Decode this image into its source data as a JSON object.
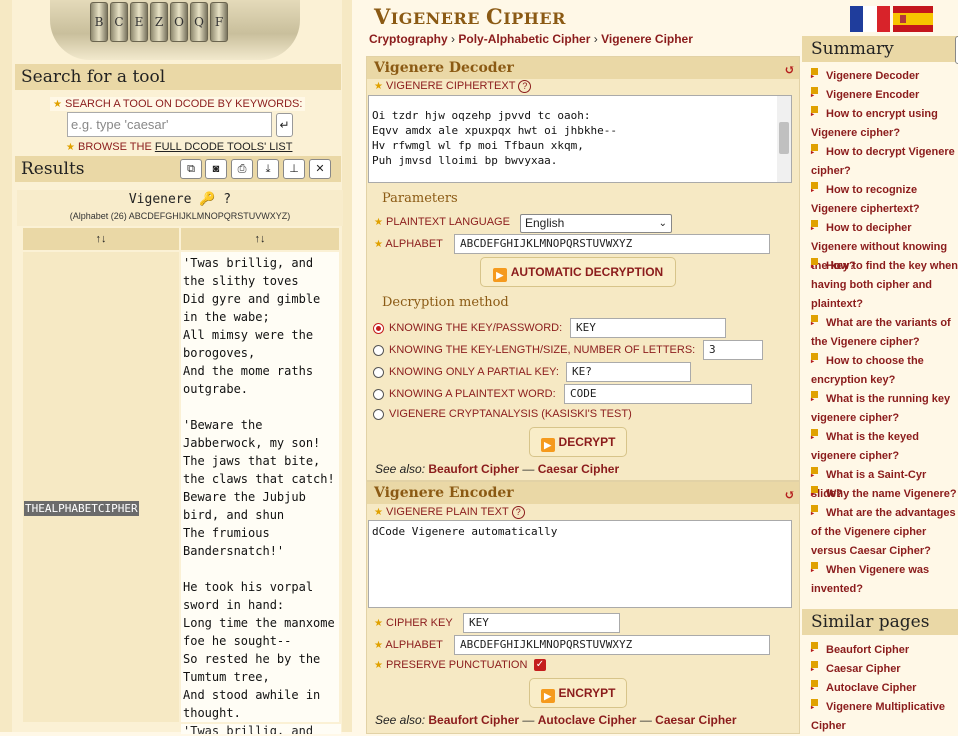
{
  "search": {
    "heading": "Search for a tool",
    "keywords_label": "SEARCH A TOOL ON DCODE BY KEYWORDS:",
    "placeholder": "e.g. type 'caesar'",
    "browse_prefix": "BROWSE THE",
    "browse_link": "FULL DCODE TOOLS' LIST"
  },
  "results": {
    "heading": "Results",
    "title": "Vigenere",
    "title_icons": "🔑 ?",
    "subtitle": "(Alphabet (26) ABCDEFGHIJKLMNOPQRSTUVWXYZ)",
    "col1_sort": "↑↓",
    "col2_sort": "↑↓",
    "key_cell": "THEALPHABETCIPHER",
    "plaintext": "'Twas brillig, and\nthe slithy toves\nDid gyre and gimble\nin the wabe;\nAll mimsy were the\nborogoves,\nAnd the mome raths\noutgrabe.\n\n'Beware the\nJabberwock, my son!\nThe jaws that bite,\nthe claws that catch!\nBeware the Jubjub\nbird, and shun\nThe frumious\nBandersnatch!'\n\nHe took his vorpal\nsword in hand:\nLong time the manxome\nfoe he sought--\nSo rested he by the\nTumtum tree,\nAnd stood awhile in\nthought.",
    "next_row": "'Twas brillig, and"
  },
  "page": {
    "title_first": "V",
    "title_rest1": "IGENERE ",
    "title_second": "C",
    "title_rest2": "IPHER",
    "breadcrumb": [
      "Cryptography",
      "Poly-Alphabetic Cipher",
      "Vigenere Cipher"
    ],
    "breadcrumb_sep": "›"
  },
  "decoder": {
    "heading": "Vigenere Decoder",
    "reload": "↺",
    "ciphertext_label": "VIGENERE CIPHERTEXT",
    "ciphertext": "Oi tzdr hjw oqzehp jpvvd tc oaoh:\nEqvv amdx ale xpuxpqx hwt oi jhbkhe--\nHv rfwmgl wl fp moi Tfbaun xkqm,\nPuh jmvsd lloimi bp bwvyxaa.",
    "parameters_heading": "Parameters",
    "language_label": "PLAINTEXT LANGUAGE",
    "language_value": "English",
    "alphabet_label": "ALPHABET",
    "alphabet_value": "ABCDEFGHIJKLMNOPQRSTUVWXYZ",
    "auto_button": "AUTOMATIC DECRYPTION",
    "method_heading": "Decryption method",
    "methods": [
      {
        "label": "KNOWING THE KEY/PASSWORD:",
        "value": "KEY",
        "selected": true
      },
      {
        "label": "KNOWING THE KEY-LENGTH/SIZE, NUMBER OF LETTERS:",
        "value": "3",
        "selected": false
      },
      {
        "label": "KNOWING ONLY A PARTIAL KEY:",
        "value": "KE?",
        "selected": false
      },
      {
        "label": "KNOWING A PLAINTEXT WORD:",
        "value": "CODE",
        "selected": false
      },
      {
        "label": "VIGENERE CRYPTANALYSIS (KASISKI'S TEST)",
        "value": "",
        "selected": false
      }
    ],
    "decrypt_button": "DECRYPT",
    "see_also_prefix": "See also:",
    "see_also": [
      "Beaufort Cipher",
      "Caesar Cipher"
    ],
    "dash": "—"
  },
  "encoder": {
    "heading": "Vigenere Encoder",
    "reload": "↺",
    "plain_label": "VIGENERE PLAIN TEXT",
    "plain_value": "dCode Vigenere automatically",
    "key_label": "CIPHER KEY",
    "key_value": "KEY",
    "alphabet_label": "ALPHABET",
    "alphabet_value": "ABCDEFGHIJKLMNOPQRSTUVWXYZ",
    "punct_label": "PRESERVE PUNCTUATION",
    "encrypt_button": "ENCRYPT",
    "see_also_prefix": "See also:",
    "see_also": [
      "Beaufort Cipher",
      "Autoclave Cipher",
      "Caesar Cipher"
    ],
    "dash": "—"
  },
  "summary": {
    "heading": "Summary",
    "items": [
      "Vigenere Decoder",
      "Vigenere Encoder",
      "How to encrypt using Vigenere cipher?",
      "How to decrypt Vigenere cipher?",
      "How to recognize Vigenere ciphertext?",
      "How to decipher Vigenere without knowing the key?",
      "How to find the key when having both cipher and plaintext?",
      "What are the variants of the Vigenere cipher?",
      "How to choose the encryption key?",
      "What is the running key vigenere cipher?",
      "What is the keyed vigenere cipher?",
      "What is a Saint-Cyr slide?",
      "Why the name Vigenere?",
      "What are the advantages of the Vigenere cipher versus Caesar Cipher?",
      "When Vigenere was invented?"
    ]
  },
  "similar": {
    "heading": "Similar pages",
    "items": [
      "Beaufort Cipher",
      "Caesar Cipher",
      "Autoclave Cipher",
      "Vigenere Multiplicative Cipher"
    ]
  },
  "colors": {
    "accent": "#8b1c1c",
    "title": "#8b5a14",
    "panel": "#f6e9c4",
    "header": "#ead8a6"
  }
}
